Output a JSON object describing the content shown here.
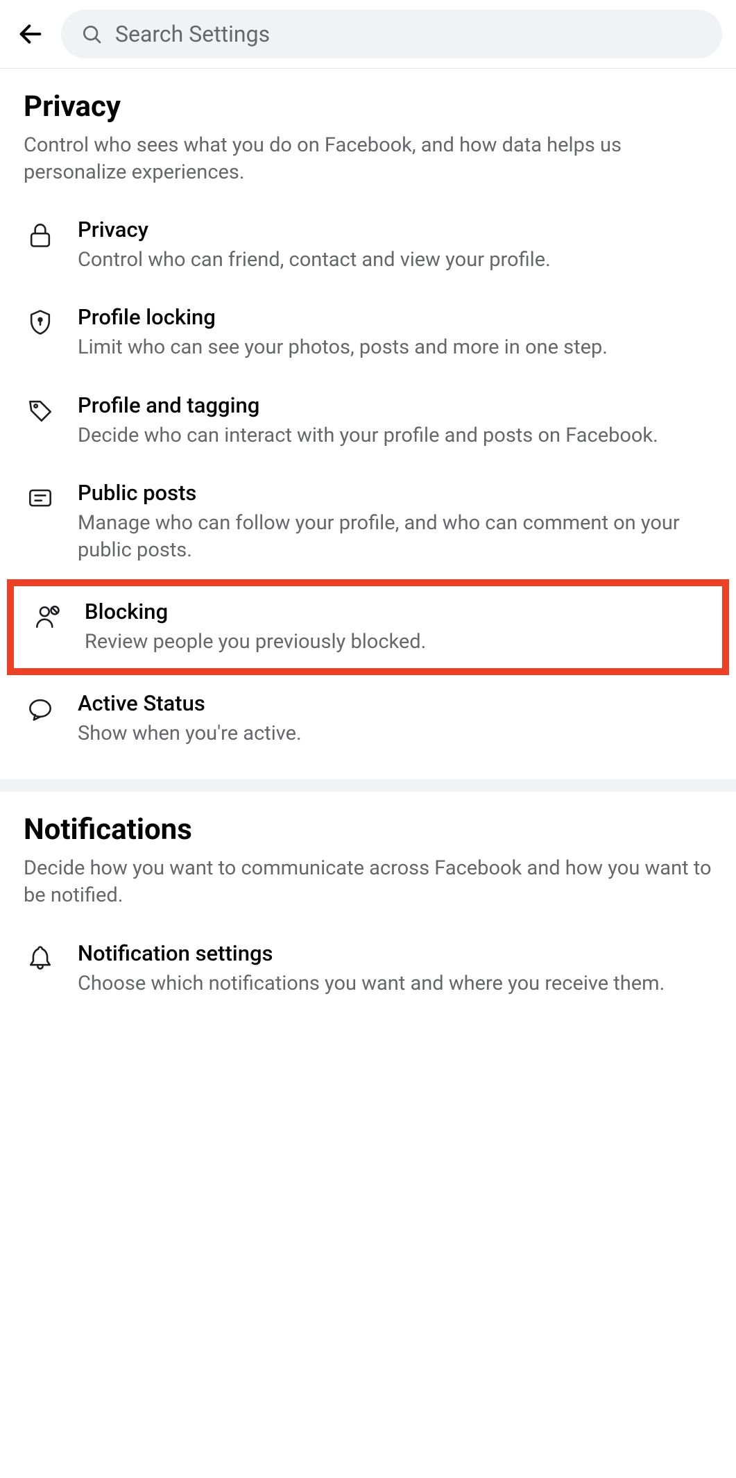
{
  "header": {
    "search_placeholder": "Search Settings"
  },
  "sections": {
    "privacy": {
      "title": "Privacy",
      "desc": "Control who sees what you do on Facebook, and how data helps us personalize experiences.",
      "items": [
        {
          "title": "Privacy",
          "desc": "Control who can friend, contact and view your profile."
        },
        {
          "title": "Profile locking",
          "desc": "Limit who can see your photos, posts and more in one step."
        },
        {
          "title": "Profile and tagging",
          "desc": "Decide who can interact with your profile and posts on Facebook."
        },
        {
          "title": "Public posts",
          "desc": "Manage who can follow your profile, and who can comment on your public posts."
        },
        {
          "title": "Blocking",
          "desc": "Review people you previously blocked."
        },
        {
          "title": "Active Status",
          "desc": "Show when you're active."
        }
      ]
    },
    "notifications": {
      "title": "Notifications",
      "desc": "Decide how you want to communicate across Facebook and how you want to be notified.",
      "items": [
        {
          "title": "Notification settings",
          "desc": "Choose which notifications you want and where you receive them."
        }
      ]
    }
  }
}
